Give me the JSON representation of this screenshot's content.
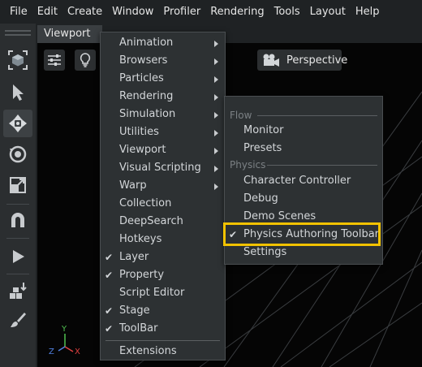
{
  "menubar": {
    "items": [
      "File",
      "Edit",
      "Create",
      "Window",
      "Profiler",
      "Rendering",
      "Tools",
      "Layout",
      "Help"
    ]
  },
  "viewport": {
    "tab_label": "Viewport",
    "camera_label": "Perspective",
    "axes": {
      "y": "Y",
      "z": "Z",
      "x": "X"
    }
  },
  "window_menu": {
    "items": [
      {
        "label": "Animation",
        "submenu": true,
        "checked": false
      },
      {
        "label": "Browsers",
        "submenu": true,
        "checked": false
      },
      {
        "label": "Particles",
        "submenu": true,
        "checked": false
      },
      {
        "label": "Rendering",
        "submenu": true,
        "checked": false
      },
      {
        "label": "Simulation",
        "submenu": true,
        "checked": false
      },
      {
        "label": "Utilities",
        "submenu": true,
        "checked": false
      },
      {
        "label": "Viewport",
        "submenu": true,
        "checked": false
      },
      {
        "label": "Visual Scripting",
        "submenu": true,
        "checked": false
      },
      {
        "label": "Warp",
        "submenu": true,
        "checked": false
      },
      {
        "label": "Collection",
        "submenu": false,
        "checked": false
      },
      {
        "label": "DeepSearch",
        "submenu": false,
        "checked": false
      },
      {
        "label": "Hotkeys",
        "submenu": false,
        "checked": false
      },
      {
        "label": "Layer",
        "submenu": false,
        "checked": true
      },
      {
        "label": "Property",
        "submenu": false,
        "checked": true
      },
      {
        "label": "Script Editor",
        "submenu": false,
        "checked": false
      },
      {
        "label": "Stage",
        "submenu": false,
        "checked": true
      },
      {
        "label": "ToolBar",
        "submenu": false,
        "checked": true
      },
      {
        "label": "Extensions",
        "submenu": false,
        "checked": false
      }
    ]
  },
  "simulation_submenu": {
    "flow_header": "Flow",
    "flow_items": [
      "Monitor",
      "Presets"
    ],
    "physics_header": "Physics",
    "physics_items": [
      {
        "label": "Character Controller",
        "checked": false
      },
      {
        "label": "Debug",
        "checked": false
      },
      {
        "label": "Demo Scenes",
        "checked": false
      },
      {
        "label": "Physics Authoring Toolbar",
        "checked": true
      },
      {
        "label": "Settings",
        "checked": false
      }
    ]
  },
  "colors": {
    "highlight": "#f2c200",
    "menu_bg": "#2d3133",
    "axis_x": "#e04040",
    "axis_y": "#50c050",
    "axis_z": "#5080e0"
  },
  "icons": {
    "left_toolbar": [
      "select-mode-icon",
      "pointer-icon",
      "move-icon",
      "rotate-icon",
      "scale-icon",
      "snap-icon",
      "play-icon",
      "physics-icon",
      "paint-icon"
    ]
  }
}
